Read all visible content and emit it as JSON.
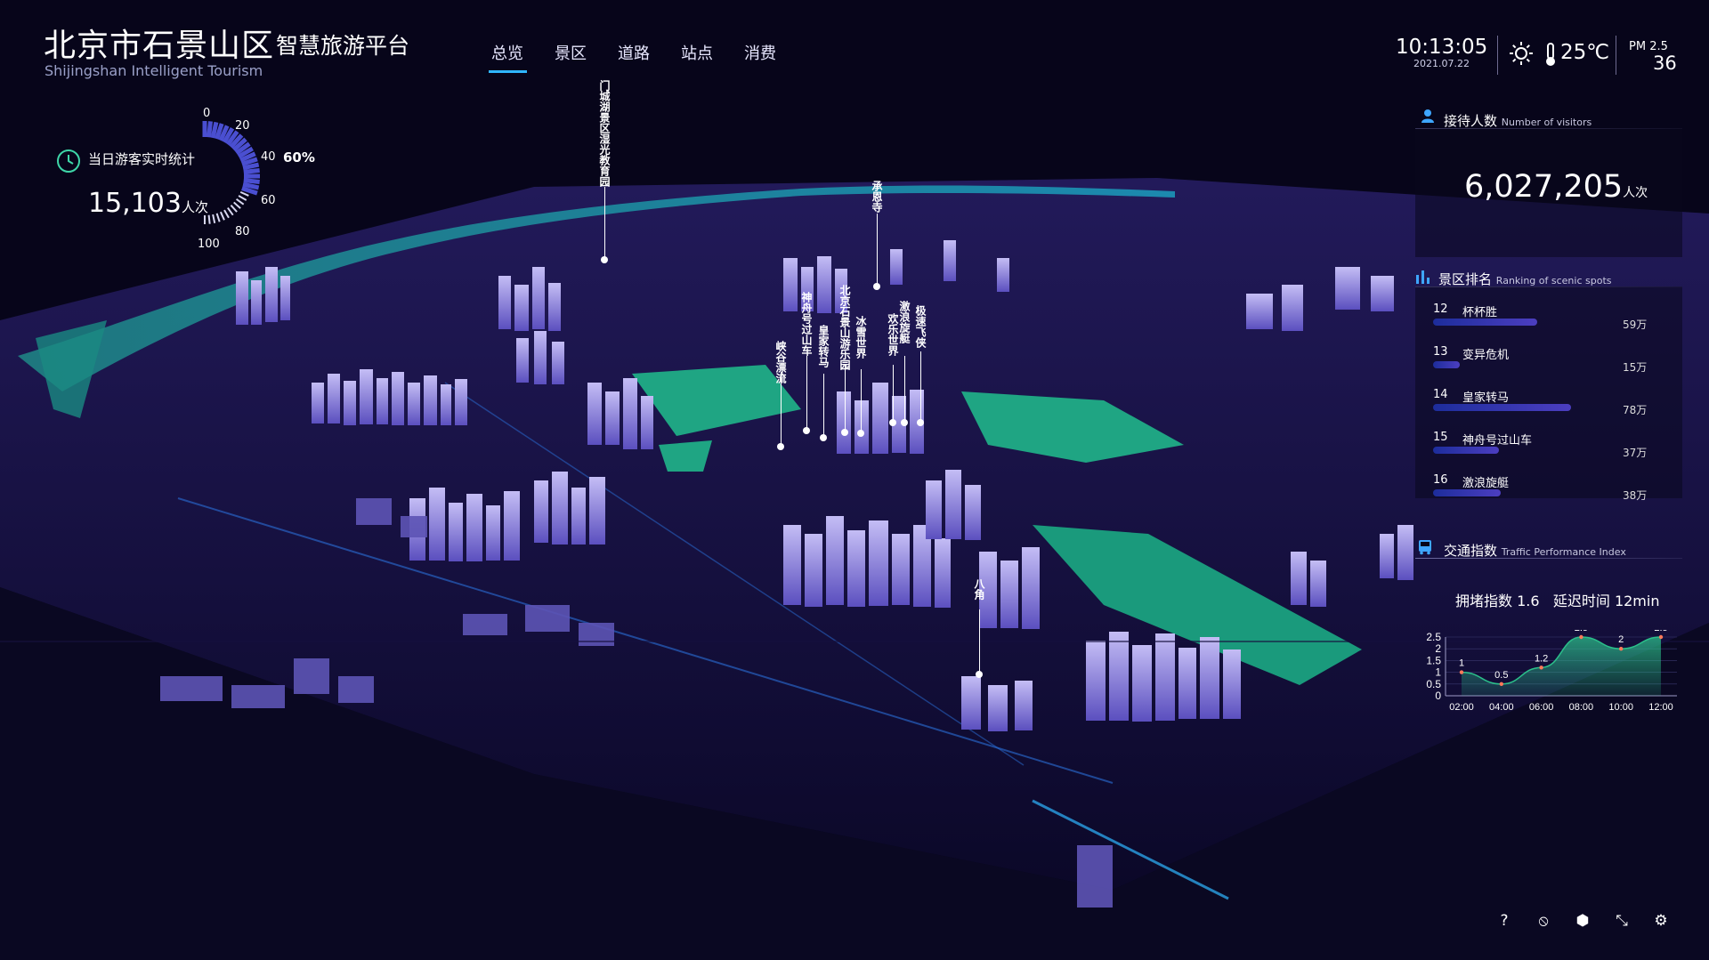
{
  "header": {
    "title": "北京市石景山区",
    "subtitle": "智慧旅游平台",
    "title_en": "Shijingshan Intelligent Tourism",
    "nav": [
      {
        "label": "总览",
        "active": true
      },
      {
        "label": "景区",
        "active": false
      },
      {
        "label": "道路",
        "active": false
      },
      {
        "label": "站点",
        "active": false
      },
      {
        "label": "消费",
        "active": false
      }
    ],
    "time": "10:13:05",
    "date": "2021.07.22",
    "weather_icon": "sun-icon",
    "temperature": "25℃",
    "pm_label": "PM 2.5",
    "pm_value": "36"
  },
  "realtime": {
    "title": "当日游客实时统计",
    "count": "15,103",
    "unit": "人次",
    "percent": "60%",
    "percent_value": 60,
    "ticks": [
      "0",
      "20",
      "40",
      "60",
      "80",
      "100"
    ]
  },
  "visitors": {
    "title": "接待人数",
    "title_en": "Number of visitors",
    "value": "6,027,205",
    "unit": "人次"
  },
  "ranking": {
    "title": "景区排名",
    "title_en": "Ranking of scenic spots",
    "max": 78,
    "items": [
      {
        "rank": "12",
        "name": "杯杯胜",
        "value": 59,
        "label": "59万"
      },
      {
        "rank": "13",
        "name": "变异危机",
        "value": 15,
        "label": "15万"
      },
      {
        "rank": "14",
        "name": "皇家转马",
        "value": 78,
        "label": "78万"
      },
      {
        "rank": "15",
        "name": "神舟号过山车",
        "value": 37,
        "label": "37万"
      },
      {
        "rank": "16",
        "name": "激浪旋艇",
        "value": 38,
        "label": "38万"
      }
    ]
  },
  "traffic": {
    "title": "交通指数",
    "title_en": "Traffic Performance Index",
    "congestion_label": "拥堵指数",
    "congestion_value": "1.6",
    "delay_label": "延迟时间",
    "delay_value": "12min"
  },
  "chart_data": {
    "type": "area",
    "categories": [
      "02:00",
      "04:00",
      "06:00",
      "08:00",
      "10:00",
      "12:00"
    ],
    "values": [
      1,
      0.5,
      1.2,
      2.5,
      2,
      2.5
    ],
    "value_labels": [
      "1",
      "0.5",
      "1.2",
      "2.5",
      "2",
      "2.5"
    ],
    "y_ticks": [
      "0",
      "0.5",
      "1",
      "1.5",
      "2",
      "2.5"
    ],
    "ylim": [
      0,
      2.5
    ],
    "color": "#2bbf8a",
    "grid": true
  },
  "spots": [
    {
      "name": "门城湖景区湿光教育园"
    },
    {
      "name": "承恩寺"
    },
    {
      "name": "神舟号过山车"
    },
    {
      "name": "北京石景山游乐园"
    },
    {
      "name": "欢乐世界"
    },
    {
      "name": "激浪旋艇"
    },
    {
      "name": "极速飞侠"
    },
    {
      "name": "峡谷漂流"
    },
    {
      "name": "皇家转马"
    },
    {
      "name": "冰雪世界"
    },
    {
      "name": "八角"
    }
  ],
  "toolbar": [
    {
      "icon": "help-icon",
      "glyph": "?"
    },
    {
      "icon": "sound-icon",
      "glyph": "⦸"
    },
    {
      "icon": "cube-icon",
      "glyph": "⬢"
    },
    {
      "icon": "collapse-icon",
      "glyph": "⤡"
    },
    {
      "icon": "gear-icon",
      "glyph": "⚙"
    }
  ],
  "colors": {
    "accent": "#2fb6ff",
    "background": "#07051a",
    "building": "#7a6fd9",
    "green_area": "#1fa583"
  }
}
